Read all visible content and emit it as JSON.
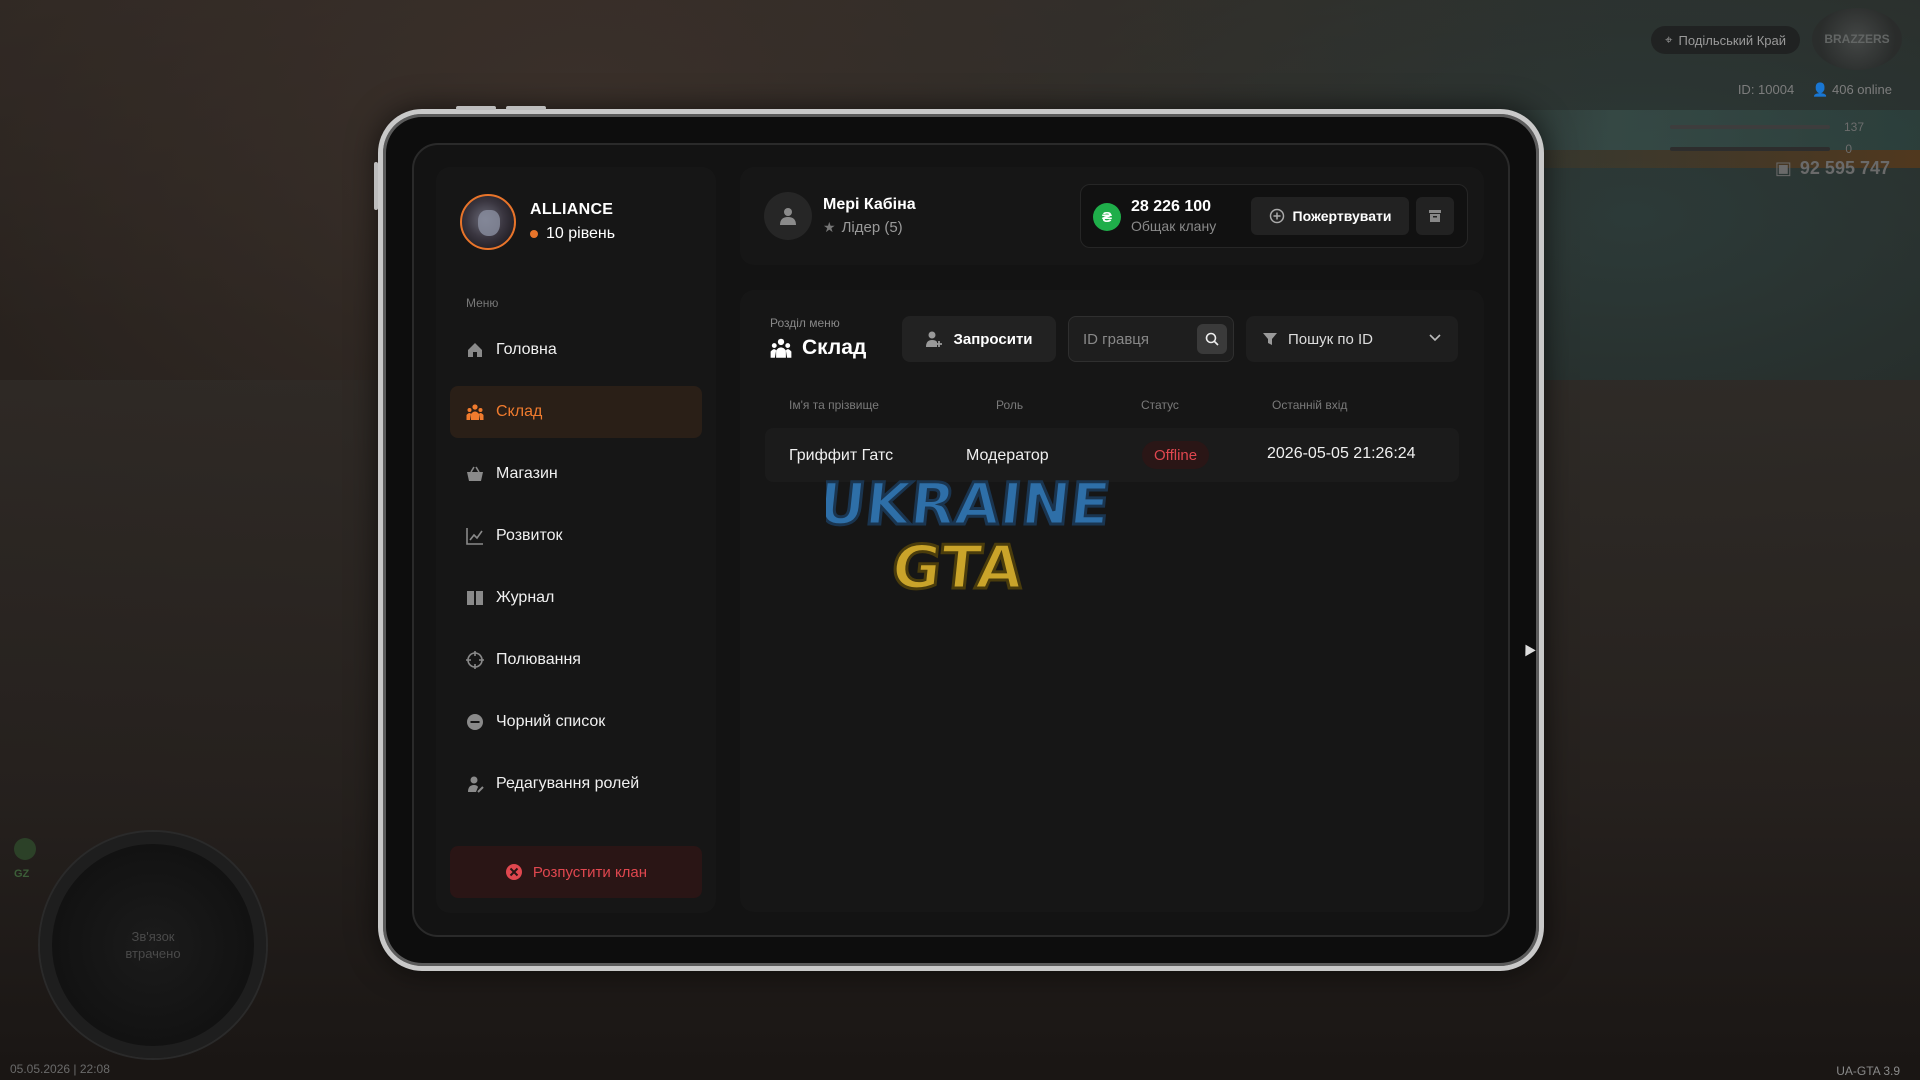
{
  "hud": {
    "region": "Подільський Край",
    "player_id": "ID: 10004",
    "online": "406 online",
    "stat1": "137",
    "stat2": "0",
    "money": "92 595 747",
    "version": "UA-GTA 3.9",
    "datetime": "05.05.2026 | 22:08",
    "minimap_status": "Зв'язок втрачено",
    "map_code": "GZ",
    "logo_text": "BRAZZERS"
  },
  "clan": {
    "name": "ALLIANCE",
    "level": "10 рівень"
  },
  "sidebar": {
    "menu_caption": "Меню",
    "items": [
      {
        "label": "Головна",
        "icon": "home-icon",
        "active": false
      },
      {
        "label": "Склад",
        "icon": "people-icon",
        "active": true
      },
      {
        "label": "Магазин",
        "icon": "basket-icon",
        "active": false
      },
      {
        "label": "Розвиток",
        "icon": "chart-icon",
        "active": false
      },
      {
        "label": "Журнал",
        "icon": "book-icon",
        "active": false
      },
      {
        "label": "Полювання",
        "icon": "crosshair-icon",
        "active": false
      },
      {
        "label": "Чорний список",
        "icon": "minus-circle-icon",
        "active": false
      },
      {
        "label": "Редагування ролей",
        "icon": "user-edit-icon",
        "active": false
      }
    ],
    "disband_label": "Розпустити клан"
  },
  "profile": {
    "name": "Мері Кабіна",
    "role": "Лідер (5)"
  },
  "fund": {
    "amount": "28 226 100",
    "label": "Общак клану",
    "currency_symbol": "₴",
    "donate_label": "Пожертвувати"
  },
  "section": {
    "caption": "Розділ меню",
    "title": "Склад",
    "invite_label": "Запросити",
    "id_placeholder": "ID гравця",
    "filter_label": "Пошук по ID"
  },
  "table": {
    "headers": [
      "Ім'я та прізвище",
      "Роль",
      "Статус",
      "Останній вхід"
    ],
    "rows": [
      {
        "name": "Гриффит Гатс",
        "role": "Модератор",
        "status": "Offline",
        "last_login": "2026-05-05 21:26:24"
      }
    ]
  },
  "watermark": {
    "line1": "UKRAINE",
    "line2": "GTA"
  },
  "colors": {
    "accent": "#f07b2e",
    "danger": "#e0474f",
    "money": "#1fae4a",
    "panel": "#161616"
  }
}
